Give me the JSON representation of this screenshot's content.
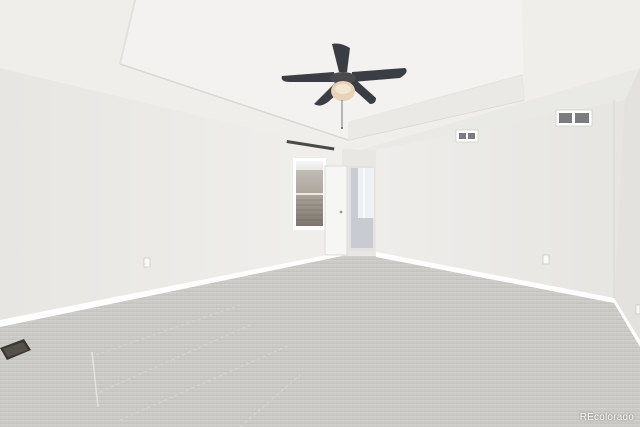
{
  "photo": {
    "subject": "empty-bedroom",
    "watermark": "REcolorado"
  },
  "colors": {
    "wall": "#ecebe8",
    "wall_shadow": "#dcdbd7",
    "ceiling": "#f1f0ee",
    "carpet": "#c9c8c4",
    "baseboard": "#ffffff",
    "fan_blade": "#3a3d44",
    "fan_light": "#e8d2b8"
  },
  "icons": [
    "ceiling-fan-icon",
    "air-vent-icon",
    "power-outlet-icon",
    "floor-vent-icon"
  ]
}
